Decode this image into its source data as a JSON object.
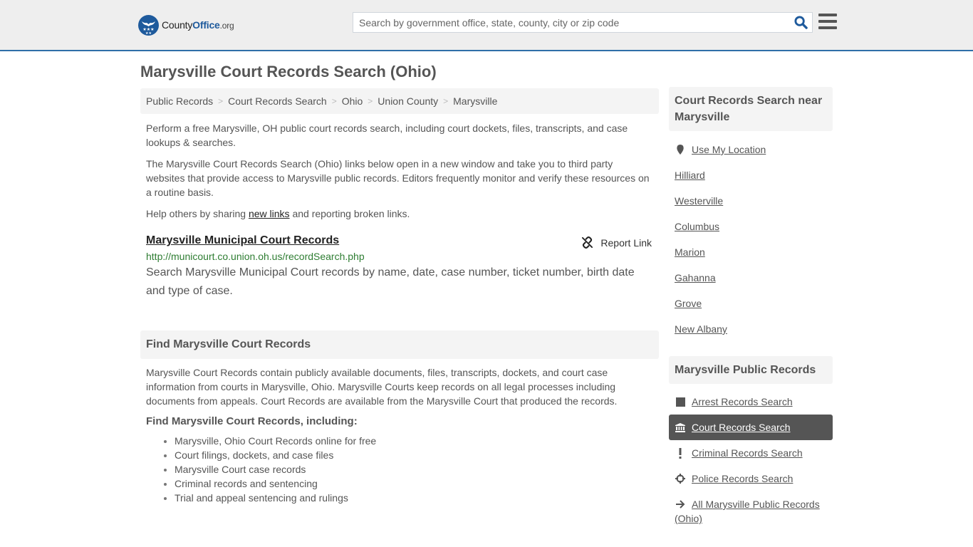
{
  "header": {
    "logo": {
      "name": "County",
      "office": "Office",
      "tld": ".org"
    },
    "search_placeholder": "Search by government office, state, county, city or zip code",
    "search_icon": "search-icon",
    "menu_icon": "hamburger-menu-icon"
  },
  "page_title": "Marysville Court Records Search (Ohio)",
  "breadcrumb": [
    {
      "label": "Public Records"
    },
    {
      "label": "Court Records Search"
    },
    {
      "label": "Ohio"
    },
    {
      "label": "Union County"
    },
    {
      "label": "Marysville"
    }
  ],
  "intro": {
    "p1": "Perform a free Marysville, OH public court records search, including court dockets, files, transcripts, and case lookups & searches.",
    "p2": "The Marysville Court Records Search (Ohio) links below open in a new window and take you to third party websites that provide access to Marysville public records. Editors frequently monitor and verify these resources on a routine basis.",
    "p3_before": "Help others by sharing ",
    "p3_link": "new links",
    "p3_after": " and reporting broken links."
  },
  "record": {
    "title": "Marysville Municipal Court Records",
    "report_label": "Report Link",
    "url": "http://municourt.co.union.oh.us/recordSearch.php",
    "description": "Search Marysville Municipal Court records by name, date, case number, ticket number, birth date and type of case."
  },
  "find_section": {
    "heading": "Find Marysville Court Records",
    "paragraph": "Marysville Court Records contain publicly available documents, files, transcripts, dockets, and court case information from courts in Marysville, Ohio. Marysville Courts keep records on all legal processes including documents from appeals. Court Records are available from the Marysville Court that produced the records.",
    "subheading": "Find Marysville Court Records, including:",
    "items": [
      "Marysville, Ohio Court Records online for free",
      "Court filings, dockets, and case files",
      "Marysville Court case records",
      "Criminal records and sentencing",
      "Trial and appeal sentencing and rulings"
    ]
  },
  "sidebar": {
    "near_heading": "Court Records Search near Marysville",
    "use_location": "Use My Location",
    "nearby": [
      "Hilliard",
      "Westerville",
      "Columbus",
      "Marion",
      "Gahanna",
      "Grove",
      "New Albany"
    ],
    "public_heading": "Marysville Public Records",
    "public_links": [
      {
        "label": "Arrest Records Search",
        "icon": "square-icon",
        "active": false
      },
      {
        "label": "Court Records Search",
        "icon": "courthouse-icon",
        "active": true
      },
      {
        "label": "Criminal Records Search",
        "icon": "exclamation-icon",
        "active": false
      },
      {
        "label": "Police Records Search",
        "icon": "crosshair-icon",
        "active": false
      },
      {
        "label": "All Marysville Public Records (Ohio)",
        "icon": "arrow-right-icon",
        "active": false
      }
    ]
  },
  "colors": {
    "brand_blue": "#1e5a9c",
    "header_bg": "#eeeeee",
    "url_green": "#2e7d32",
    "active_bg": "#555555"
  }
}
